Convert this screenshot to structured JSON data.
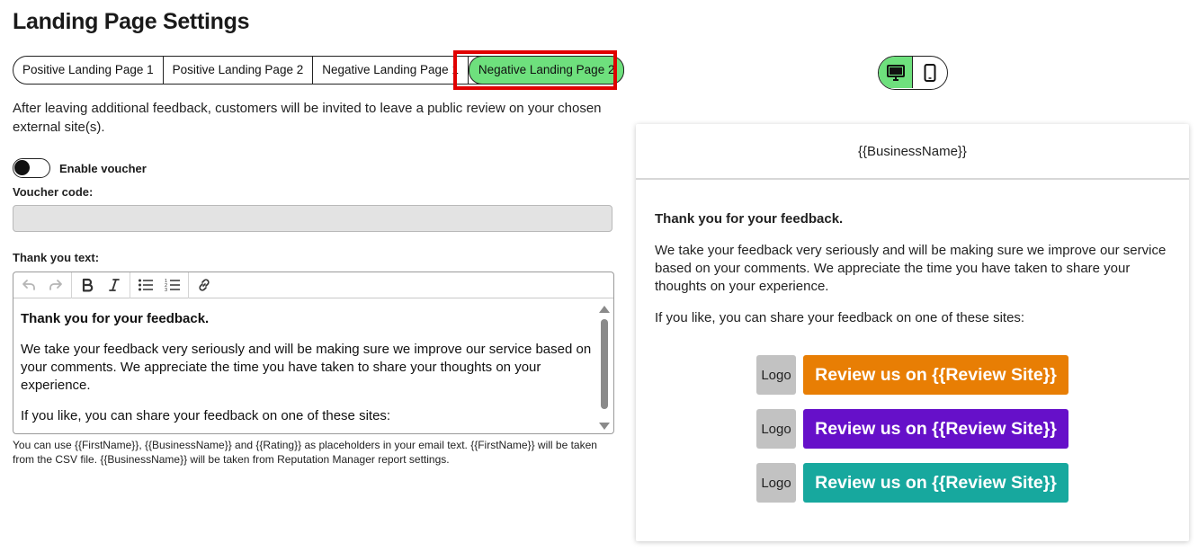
{
  "page": {
    "title": "Landing Page Settings"
  },
  "tabs": [
    {
      "label": "Positive Landing Page 1",
      "active": false
    },
    {
      "label": "Positive Landing Page 2",
      "active": false
    },
    {
      "label": "Negative Landing Page 1",
      "active": false
    },
    {
      "label": "Negative Landing Page 2",
      "active": true
    }
  ],
  "intro": "After leaving additional feedback, customers will be invited to leave a public review on your chosen external site(s).",
  "voucher": {
    "toggle_label": "Enable voucher",
    "enabled": false,
    "code_label": "Voucher code:",
    "code_value": ""
  },
  "thank_you": {
    "label": "Thank you text:",
    "toolbar_icons": [
      "undo-icon",
      "redo-icon",
      "bold-icon",
      "italic-icon",
      "bullet-list-icon",
      "numbered-list-icon",
      "link-icon"
    ],
    "heading": "Thank you for your feedback.",
    "paragraph1": "We take your feedback very seriously and will be making sure we improve our service based on your comments. We appreciate the time you have taken to share your thoughts on your experience.",
    "paragraph2": "If you like, you can share your feedback on one of these sites:"
  },
  "hint": "You can use {{FirstName}}, {{BusinessName}} and {{Rating}} as placeholders in your email text. {{FirstName}} will be taken from the CSV file. {{BusinessName}} will be taken from Reputation Manager report settings.",
  "device_toggle": {
    "active": "desktop",
    "options": [
      "desktop-icon",
      "mobile-icon"
    ]
  },
  "preview": {
    "business_name": "{{BusinessName}}",
    "heading": "Thank you for your feedback.",
    "paragraph1": "We take your feedback very seriously and will be making sure we improve our service based on your comments. We appreciate the time you have taken to share your thoughts on your experience.",
    "paragraph2": "If you like, you can share your feedback on one of these sites:",
    "reviews": [
      {
        "logo": "Logo",
        "label": "Review us on {{Review Site}}",
        "color": "#e87e04"
      },
      {
        "logo": "Logo",
        "label": "Review us on {{Review Site}}",
        "color": "#6610c9"
      },
      {
        "logo": "Logo",
        "label": "Review us on {{Review Site}}",
        "color": "#17a89e"
      }
    ]
  },
  "colors": {
    "accent_green": "#6ee07d",
    "highlight_red": "#e00000"
  }
}
